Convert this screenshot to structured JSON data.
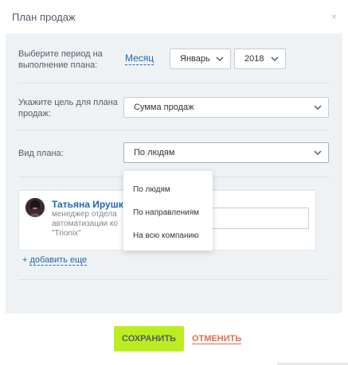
{
  "dialog": {
    "title": "План продаж",
    "close_glyph": "×"
  },
  "period": {
    "label": "Выберите период на выполнение плана:",
    "type_link": "Месяц",
    "month": "Январь",
    "year": "2018"
  },
  "goal": {
    "label": "Укажите цель для плана продаж:",
    "value": "Сумма продаж"
  },
  "plan_type": {
    "label": "Вид плана:",
    "value": "По людям",
    "options": [
      "По людям",
      "По направлениям",
      "На всю компанию"
    ]
  },
  "user": {
    "name": "Татьяна Ирушки",
    "role_line1": "менеджер отдела",
    "role_line2": "автоматизации ко",
    "role_line3": "\"Trionix\""
  },
  "add_more": {
    "prefix": "+ ",
    "label": "добавить еще"
  },
  "actions": {
    "save": "СОХРАНИТЬ",
    "cancel": "ОТМЕНИТЬ"
  },
  "icons": {
    "close": "close-icon",
    "chevron": "chevron-down-icon",
    "avatar": "avatar-image"
  },
  "colors": {
    "accent_green": "#bbed21",
    "link_blue": "#2067b0",
    "cancel_red": "#e36d4a",
    "panel_bg": "#eef2f4"
  }
}
